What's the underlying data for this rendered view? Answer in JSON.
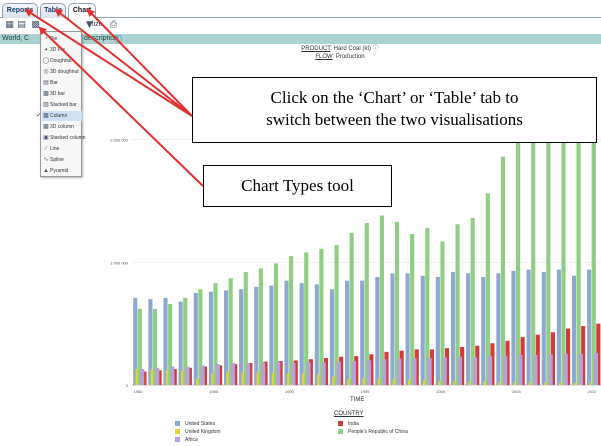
{
  "tabs": [
    {
      "label": "Reports",
      "active": false
    },
    {
      "label": "Table",
      "active": false
    },
    {
      "label": "Chart",
      "active": true
    }
  ],
  "toolbar": {
    "label_fragment": "lize",
    "icons": [
      "table-layout-icon",
      "chart-layout-icon",
      "chart-types-icon",
      "filter-icon",
      "wand-icon",
      "print-icon"
    ]
  },
  "infobar": {
    "left_text": "World, C",
    "right_text": "description"
  },
  "chart_header": {
    "product_key": "PRODUCT",
    "product_value": ": Hard Coal (kt)",
    "flow_key": "FLOW",
    "flow_value": ": Production"
  },
  "chart_types_menu": {
    "items": [
      {
        "label": "Pie",
        "icon": "pie-icon",
        "selected": false
      },
      {
        "label": "3D Pie",
        "icon": "pie-3d-icon",
        "selected": false
      },
      {
        "label": "Doughnut",
        "icon": "doughnut-icon",
        "selected": false
      },
      {
        "label": "3D doughnut",
        "icon": "doughnut-3d-icon",
        "selected": false
      },
      {
        "label": "Bar",
        "icon": "bar-icon",
        "selected": false
      },
      {
        "label": "3D bar",
        "icon": "bar-3d-icon",
        "selected": false
      },
      {
        "label": "Stacked bar",
        "icon": "stacked-bar-icon",
        "selected": false
      },
      {
        "label": "Column",
        "icon": "column-icon",
        "selected": true
      },
      {
        "label": "3D column",
        "icon": "column-3d-icon",
        "selected": false
      },
      {
        "label": "Stacked column",
        "icon": "stacked-column-icon",
        "selected": false
      },
      {
        "label": "Line",
        "icon": "line-icon",
        "selected": false
      },
      {
        "label": "Spline",
        "icon": "spline-icon",
        "selected": false
      },
      {
        "label": "Pyramid",
        "icon": "pyramid-icon",
        "selected": false
      }
    ]
  },
  "callouts": {
    "tabs_hint_line1": "Click on the ‘Chart’ or ‘Table’ tab to",
    "tabs_hint_line2": "switch between the two visualisations",
    "chart_types_hint": "Chart Types tool"
  },
  "colors": {
    "united_states": "#8ea8cf",
    "india": "#d23b3b",
    "united_kingdom": "#e3d23c",
    "china": "#8fcf84",
    "africa": "#b6a2d6",
    "arrow": "#e03030",
    "infobar": "#a9d2d0"
  },
  "chart_data": {
    "type": "bar",
    "title": "",
    "xlabel": "TIME",
    "ylabel": "",
    "ylim": [
      0,
      2000000
    ],
    "yticks": [
      "0",
      "1 000 000",
      "2 000 000"
    ],
    "xtick_labels": [
      "1980",
      "1985",
      "1990",
      "1995",
      "2000",
      "2005",
      "2010"
    ],
    "categories": [
      "1980",
      "1981",
      "1982",
      "1983",
      "1984",
      "1985",
      "1986",
      "1987",
      "1988",
      "1989",
      "1990",
      "1991",
      "1992",
      "1993",
      "1994",
      "1995",
      "1996",
      "1997",
      "1998",
      "1999",
      "2000",
      "2001",
      "2002",
      "2003",
      "2004",
      "2005",
      "2006",
      "2007",
      "2008",
      "2009",
      "2010"
    ],
    "legend_title": "COUNTRY",
    "series": [
      {
        "name": "United States",
        "color": "#8ea8cf",
        "values": [
          710000,
          700000,
          710000,
          680000,
          750000,
          760000,
          770000,
          780000,
          800000,
          810000,
          850000,
          830000,
          820000,
          780000,
          850000,
          850000,
          880000,
          910000,
          910000,
          890000,
          880000,
          920000,
          910000,
          880000,
          910000,
          930000,
          940000,
          920000,
          940000,
          890000,
          940000
        ]
      },
      {
        "name": "India",
        "color": "#d23b3b",
        "values": [
          110000,
          120000,
          130000,
          140000,
          150000,
          160000,
          170000,
          180000,
          190000,
          195000,
          200000,
          210000,
          220000,
          230000,
          235000,
          250000,
          270000,
          280000,
          290000,
          290000,
          300000,
          310000,
          320000,
          340000,
          360000,
          390000,
          410000,
          430000,
          460000,
          480000,
          500000
        ]
      },
      {
        "name": "United Kingdom",
        "color": "#e3d23c",
        "values": [
          130000,
          125000,
          120000,
          116000,
          51000,
          94000,
          108000,
          104000,
          104000,
          100000,
          93000,
          94000,
          84000,
          68000,
          48000,
          53000,
          50000,
          48000,
          41000,
          37000,
          31000,
          32000,
          30000,
          28000,
          25000,
          20000,
          19000,
          17000,
          18000,
          18000,
          18000
        ]
      },
      {
        "name": "People's Republic of China",
        "color": "#8fcf84",
        "values": [
          620000,
          620000,
          660000,
          710000,
          780000,
          830000,
          870000,
          920000,
          950000,
          990000,
          1050000,
          1080000,
          1110000,
          1140000,
          1240000,
          1320000,
          1380000,
          1330000,
          1230000,
          1280000,
          1170000,
          1310000,
          1360000,
          1560000,
          1860000,
          2130000,
          2370000,
          2520000,
          2700000,
          2920000,
          3140000
        ]
      },
      {
        "name": "Africa",
        "color": "#b6a2d6",
        "values": [
          130000,
          140000,
          150000,
          150000,
          160000,
          170000,
          180000,
          180000,
          180000,
          185000,
          180000,
          185000,
          185000,
          190000,
          195000,
          200000,
          210000,
          215000,
          220000,
          220000,
          225000,
          230000,
          225000,
          235000,
          240000,
          245000,
          245000,
          250000,
          255000,
          255000,
          260000
        ]
      }
    ]
  }
}
